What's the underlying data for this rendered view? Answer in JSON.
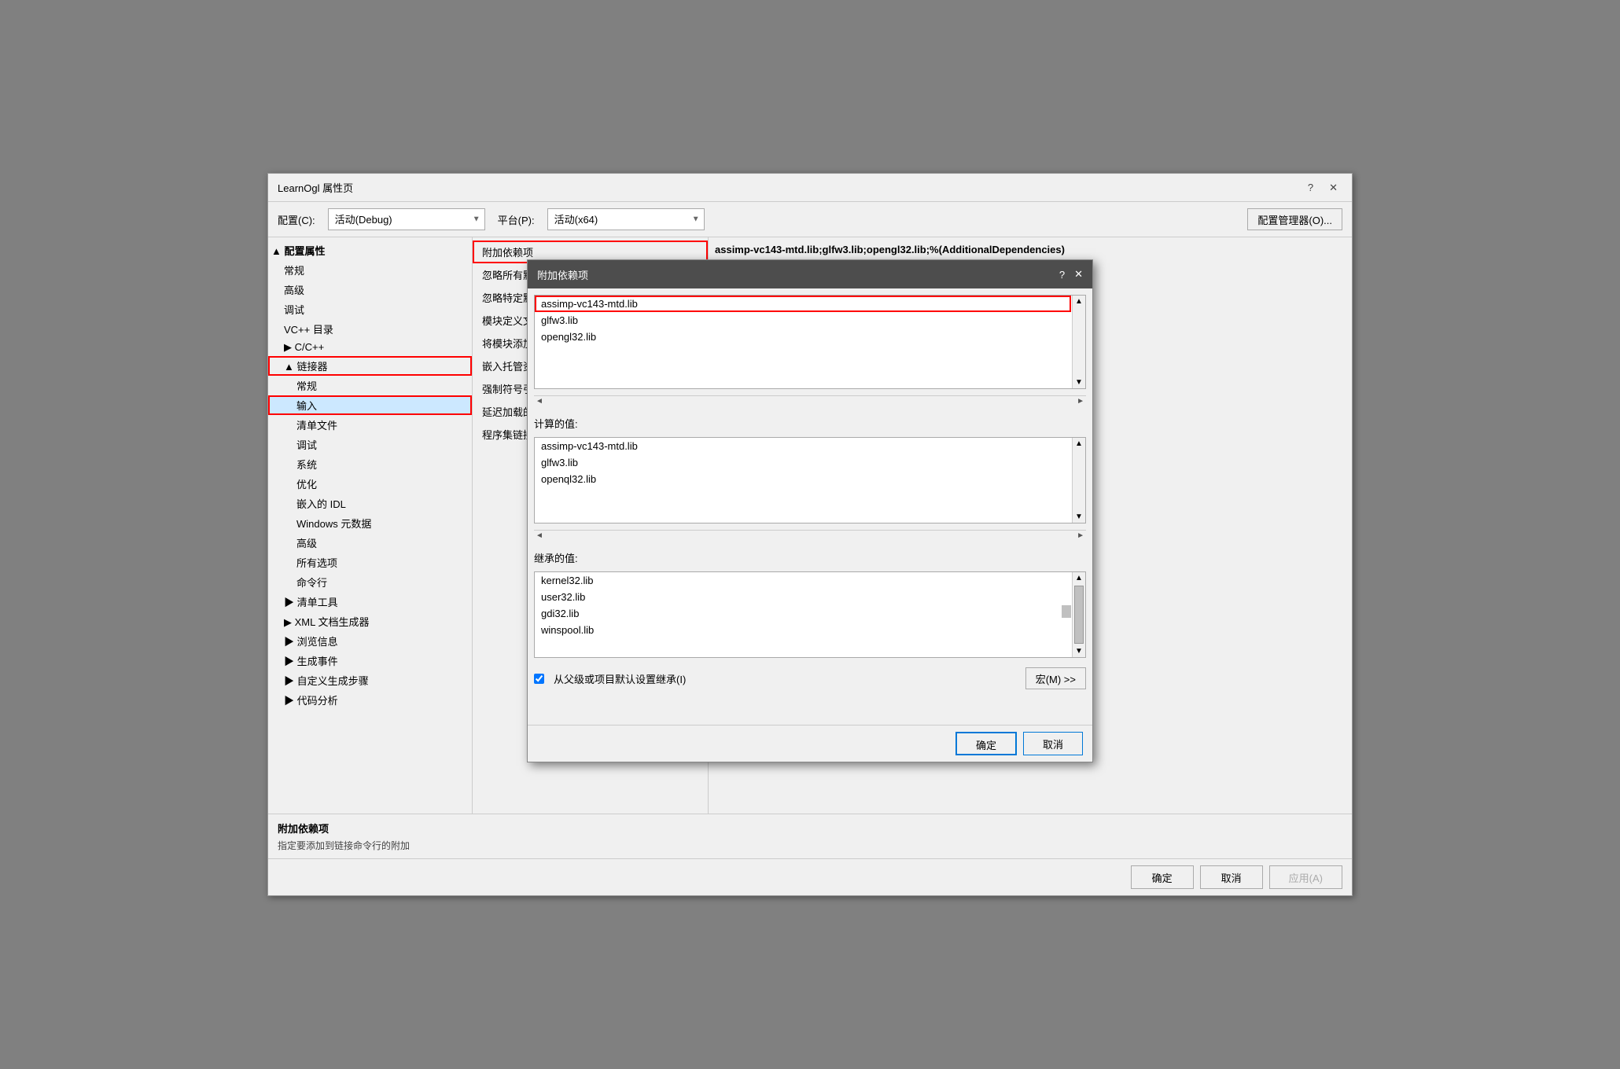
{
  "mainDialog": {
    "title": "LearnOgl 属性页",
    "helpBtn": "?",
    "closeBtn": "✕"
  },
  "configBar": {
    "configLabel": "配置(C):",
    "configValue": "活动(Debug)",
    "platformLabel": "平台(P):",
    "platformValue": "活动(x64)",
    "managerBtn": "配置管理器(O)..."
  },
  "treePanel": {
    "items": [
      {
        "id": "config-props",
        "label": "▲ 配置属性",
        "level": 0,
        "expanded": true
      },
      {
        "id": "general",
        "label": "常规",
        "level": 1
      },
      {
        "id": "advanced",
        "label": "高级",
        "level": 1
      },
      {
        "id": "debug",
        "label": "调试",
        "level": 1
      },
      {
        "id": "vcpp-dirs",
        "label": "VC++ 目录",
        "level": 1
      },
      {
        "id": "cpp",
        "label": "▶ C/C++",
        "level": 1
      },
      {
        "id": "linker",
        "label": "▲ 链接器",
        "level": 1,
        "highlighted": true
      },
      {
        "id": "link-general",
        "label": "常规",
        "level": 2
      },
      {
        "id": "link-input",
        "label": "输入",
        "level": 2,
        "selected": true,
        "highlighted": true
      },
      {
        "id": "manifest-file",
        "label": "清单文件",
        "level": 2
      },
      {
        "id": "link-debug",
        "label": "调试",
        "level": 2
      },
      {
        "id": "system",
        "label": "系统",
        "level": 2
      },
      {
        "id": "optimize",
        "label": "优化",
        "level": 2
      },
      {
        "id": "embedded-idl",
        "label": "嵌入的 IDL",
        "level": 2
      },
      {
        "id": "windows-meta",
        "label": "Windows 元数据",
        "level": 2
      },
      {
        "id": "advanced2",
        "label": "高级",
        "level": 2
      },
      {
        "id": "all-options",
        "label": "所有选项",
        "level": 2
      },
      {
        "id": "command-line",
        "label": "命令行",
        "level": 2
      },
      {
        "id": "manifest-tool",
        "label": "▶ 清单工具",
        "level": 1
      },
      {
        "id": "xml-gen",
        "label": "▶ XML 文档生成器",
        "level": 1
      },
      {
        "id": "browse-info",
        "label": "▶ 浏览信息",
        "level": 1
      },
      {
        "id": "build-events",
        "label": "▶ 生成事件",
        "level": 1
      },
      {
        "id": "custom-steps",
        "label": "▶ 自定义生成步骤",
        "level": 1
      },
      {
        "id": "code-analysis",
        "label": "▶ 代码分析",
        "level": 1
      }
    ]
  },
  "propertyPanel": {
    "items": [
      {
        "id": "additional-deps",
        "label": "附加依赖项",
        "highlighted": true
      },
      {
        "id": "ignore-all",
        "label": "忽略所有默认库"
      },
      {
        "id": "ignore-specific",
        "label": "忽略特定默认库"
      },
      {
        "id": "module-def",
        "label": "模块定义文件"
      },
      {
        "id": "add-module",
        "label": "将模块添加到程序集"
      },
      {
        "id": "embed-managed",
        "label": "嵌入托管资源文件"
      },
      {
        "id": "force-symbol",
        "label": "强制符号引用"
      },
      {
        "id": "delay-load",
        "label": "延迟加载的 DLL"
      },
      {
        "id": "assembly-res",
        "label": "程序集链接资源"
      }
    ]
  },
  "valuePanel": {
    "value": "assimp-vc143-mtd.lib;glfw3.lib;opengl32.lib;%(AdditionalDependencies)"
  },
  "bottomPanel": {
    "propName": "附加依赖项",
    "propDesc": "指定要添加到链接命令行的附加"
  },
  "dialogFooter": {
    "okBtn": "确定",
    "cancelBtn": "取消",
    "applyBtn": "应用(A)"
  },
  "modalDialog": {
    "title": "附加依赖项",
    "helpBtn": "?",
    "closeBtn": "✕",
    "editList": {
      "items": [
        {
          "label": "assimp-vc143-mtd.lib",
          "highlighted": true
        },
        {
          "label": "glfw3.lib",
          "highlighted": false
        },
        {
          "label": "opengl32.lib",
          "highlighted": false
        }
      ]
    },
    "computedLabel": "计算的值:",
    "computedList": {
      "items": [
        "assimp-vc143-mtd.lib",
        "glfw3.lib",
        "openql32.lib"
      ]
    },
    "inheritedLabel": "继承的值:",
    "inheritedList": {
      "items": [
        "kernel32.lib",
        "user32.lib",
        "gdi32.lib",
        "winspool.lib"
      ]
    },
    "checkboxLabel": "从父级或项目默认设置继承(I)",
    "macroBtn": "宏(M) >>",
    "okBtn": "确定",
    "cancelBtn": "取消"
  }
}
